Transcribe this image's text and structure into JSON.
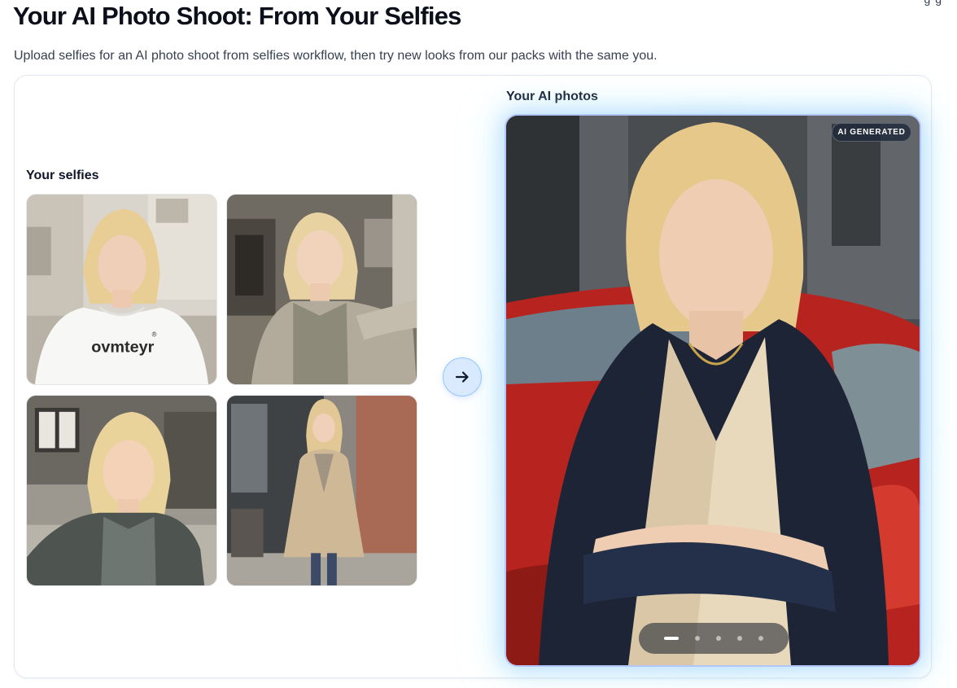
{
  "header": {
    "title": "Your AI Photo Shoot: From Your Selfies",
    "subtitle": "Upload selfies for an AI photo shoot from selfies workflow, then try new looks from our packs with the same you.",
    "corner_fragment": "g  g"
  },
  "selfies_panel": {
    "label": "Your selfies",
    "images": [
      {
        "name": "selfie-white-tshirt",
        "shirt_text": "ovmteyr",
        "registered_mark": "®"
      },
      {
        "name": "selfie-grey-cardigan"
      },
      {
        "name": "selfie-outdoor-jacket"
      },
      {
        "name": "selfie-trench-coat"
      }
    ]
  },
  "transform_button": {
    "icon": "arrow-right-icon"
  },
  "ai_panel": {
    "label": "Your AI photos",
    "badge": "AI GENERATED",
    "carousel": {
      "count": 5,
      "active_index": 0
    }
  },
  "colors": {
    "accent_blue": "#dbeafe",
    "glow": "#93c5fd",
    "title": "#0b0f19"
  }
}
